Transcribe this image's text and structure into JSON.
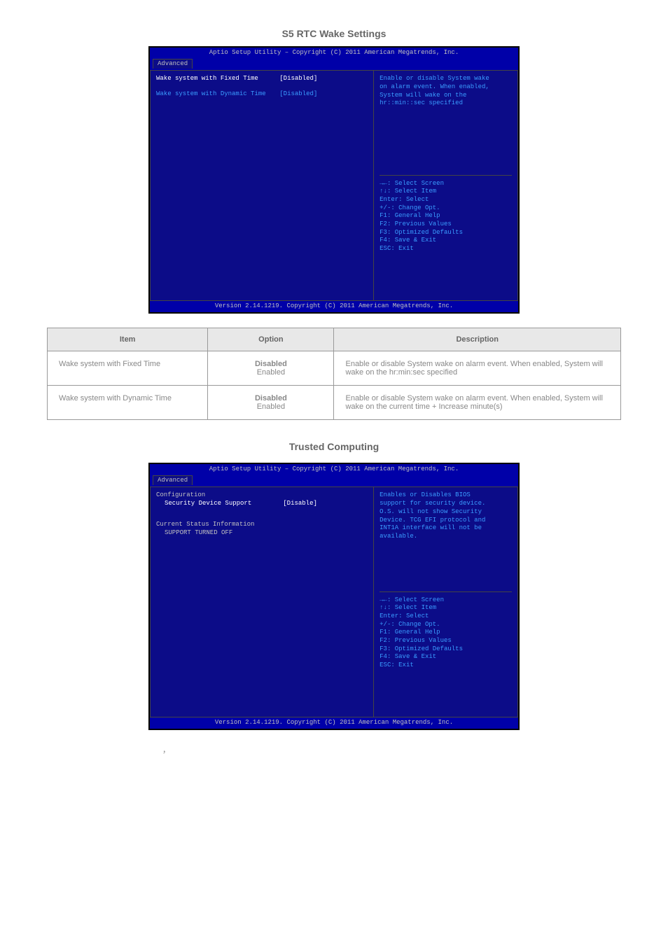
{
  "page_title_1": "S5 RTC Wake Settings",
  "bios1": {
    "header": "Aptio Setup Utility – Copyright (C) 2011 American Megatrends, Inc.",
    "tab": "Advanced",
    "rows": [
      {
        "label": "Wake system with Fixed Time",
        "value": "[Disabled]",
        "selected": true
      },
      {
        "label": "Wake system with Dynamic Time",
        "value": "[Disabled]",
        "selected": false
      }
    ],
    "help1": "Enable or disable System wake",
    "help2": "on alarm event. When enabled,",
    "help3": "System will wake on the",
    "help4": "hr::min::sec specified",
    "nav": [
      "→←: Select Screen",
      "↑↓: Select Item",
      "Enter: Select",
      "+/-: Change Opt.",
      "F1: General Help",
      "F2: Previous Values",
      "F3: Optimized Defaults",
      "F4: Save & Exit",
      "ESC: Exit"
    ],
    "footer": "Version 2.14.1219. Copyright (C) 2011 American Megatrends, Inc."
  },
  "table1": {
    "h1": "Item",
    "h2": "Option",
    "h3": "Description",
    "r1c1": "Wake system with Fixed Time",
    "r1c2a": "Disabled",
    "r1c2b": "Enabled",
    "r1c3": "Enable or disable System wake on alarm event. When enabled, System will wake on the hr:min:sec specified",
    "r2c1": "Wake system with Dynamic Time",
    "r2c2a": "Disabled",
    "r2c2b": "Enabled",
    "r2c3": "Enable or disable System wake on alarm event. When enabled, System will wake on the current time + Increase minute(s)"
  },
  "page_title_2": "Trusted Computing",
  "bios2": {
    "header": "Aptio Setup Utility – Copyright (C) 2011 American Megatrends, Inc.",
    "tab": "Advanced",
    "line1": "Configuration",
    "row_label": "Security Device Support",
    "row_value": "[Disable]",
    "line2": "Current Status Information",
    "line3": "SUPPORT TURNED OFF",
    "help1": "Enables or Disables BIOS",
    "help2": "support for security device.",
    "help3": "O.S. will not show Security",
    "help4": "Device. TCG EFI protocol and",
    "help5": "INT1A interface will not be",
    "help6": "available.",
    "nav": [
      "→←: Select Screen",
      "↑↓: Select Item",
      "Enter: Select",
      "+/-: Change Opt.",
      "F1: General Help",
      "F2: Previous Values",
      "F3: Optimized Defaults",
      "F4: Save & Exit",
      "ESC: Exit"
    ],
    "footer": "Version 2.14.1219. Copyright (C) 2011 American Megatrends, Inc."
  },
  "caption2": "，"
}
